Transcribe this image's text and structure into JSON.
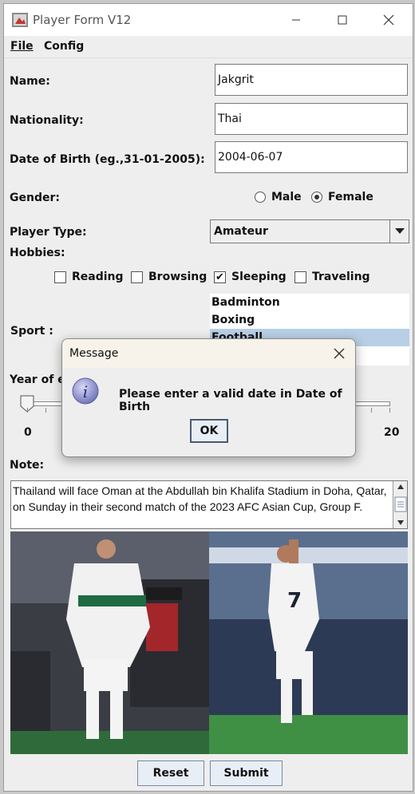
{
  "window": {
    "title": "Player Form V12"
  },
  "menu": {
    "file": "File",
    "config": "Config"
  },
  "form": {
    "name_label": "Name:",
    "name_value": "Jakgrit",
    "nationality_label": "Nationality:",
    "nationality_value": "Thai",
    "dob_label": "Date of Birth (eg.,31-01-2005):",
    "dob_value": "2004-06-07",
    "gender_label": "Gender:",
    "gender_male": "Male",
    "gender_female": "Female",
    "gender_selected": "Female",
    "player_type_label": "Player Type:",
    "player_type_value": "Amateur",
    "hobbies_label": "Hobbies:",
    "hobbies": [
      {
        "label": "Reading",
        "checked": false
      },
      {
        "label": "Browsing",
        "checked": false
      },
      {
        "label": "Sleeping",
        "checked": true
      },
      {
        "label": "Traveling",
        "checked": false
      }
    ],
    "sport_label": "Sport :",
    "sports": [
      "Badminton",
      "Boxing",
      "Football"
    ],
    "sport_selected": "Football",
    "year_label": "Year of e",
    "slider_min": "0",
    "slider_max": "20",
    "slider_value": 0,
    "note_label": "Note:",
    "note_text": "Thailand will face Oman at the Abdullah bin Khalifa Stadium in Doha, Qatar, on Sunday in their second match of the 2023 AFC Asian Cup, Group F."
  },
  "buttons": {
    "reset": "Reset",
    "submit": "Submit"
  },
  "dialog": {
    "title": "Message",
    "message": "Please enter a valid date in Date of Birth",
    "ok": "OK",
    "icon": "info-icon"
  },
  "colors": {
    "selection": "#b8cfe5",
    "dialog_icon": "#6b6fb5"
  }
}
